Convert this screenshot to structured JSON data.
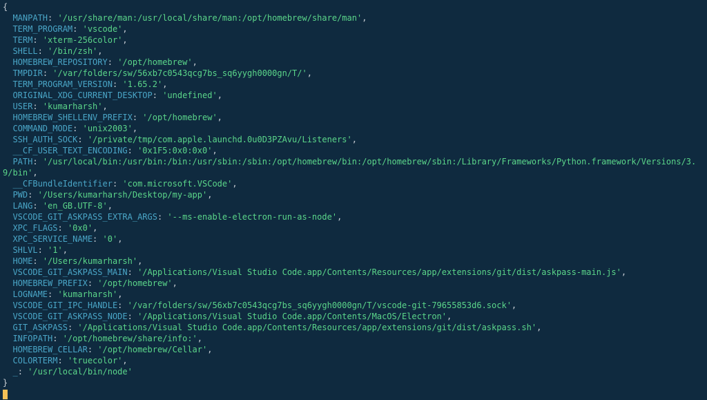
{
  "open_brace": "{",
  "close_brace": "}",
  "env": [
    {
      "key": "MANPATH",
      "value": "/usr/share/man:/usr/local/share/man:/opt/homebrew/share/man"
    },
    {
      "key": "TERM_PROGRAM",
      "value": "vscode"
    },
    {
      "key": "TERM",
      "value": "xterm-256color"
    },
    {
      "key": "SHELL",
      "value": "/bin/zsh"
    },
    {
      "key": "HOMEBREW_REPOSITORY",
      "value": "/opt/homebrew"
    },
    {
      "key": "TMPDIR",
      "value": "/var/folders/sw/56xb7c0543qcg7bs_sq6yygh0000gn/T/"
    },
    {
      "key": "TERM_PROGRAM_VERSION",
      "value": "1.65.2"
    },
    {
      "key": "ORIGINAL_XDG_CURRENT_DESKTOP",
      "value": "undefined"
    },
    {
      "key": "USER",
      "value": "kumarharsh"
    },
    {
      "key": "HOMEBREW_SHELLENV_PREFIX",
      "value": "/opt/homebrew"
    },
    {
      "key": "COMMAND_MODE",
      "value": "unix2003"
    },
    {
      "key": "SSH_AUTH_SOCK",
      "value": "/private/tmp/com.apple.launchd.0u0D3PZAvu/Listeners"
    },
    {
      "key": "__CF_USER_TEXT_ENCODING",
      "value": "0x1F5:0x0:0x0"
    },
    {
      "key": "PATH",
      "value": "/usr/local/bin:/usr/bin:/bin:/usr/sbin:/sbin:/opt/homebrew/bin:/opt/homebrew/sbin:/Library/Frameworks/Python.framework/Versions/3.9/bin"
    },
    {
      "key": "__CFBundleIdentifier",
      "value": "com.microsoft.VSCode"
    },
    {
      "key": "PWD",
      "value": "/Users/kumarharsh/Desktop/my-app"
    },
    {
      "key": "LANG",
      "value": "en_GB.UTF-8"
    },
    {
      "key": "VSCODE_GIT_ASKPASS_EXTRA_ARGS",
      "value": "--ms-enable-electron-run-as-node"
    },
    {
      "key": "XPC_FLAGS",
      "value": "0x0"
    },
    {
      "key": "XPC_SERVICE_NAME",
      "value": "0"
    },
    {
      "key": "SHLVL",
      "value": "1"
    },
    {
      "key": "HOME",
      "value": "/Users/kumarharsh"
    },
    {
      "key": "VSCODE_GIT_ASKPASS_MAIN",
      "value": "/Applications/Visual Studio Code.app/Contents/Resources/app/extensions/git/dist/askpass-main.js"
    },
    {
      "key": "HOMEBREW_PREFIX",
      "value": "/opt/homebrew"
    },
    {
      "key": "LOGNAME",
      "value": "kumarharsh"
    },
    {
      "key": "VSCODE_GIT_IPC_HANDLE",
      "value": "/var/folders/sw/56xb7c0543qcg7bs_sq6yygh0000gn/T/vscode-git-79655853d6.sock"
    },
    {
      "key": "VSCODE_GIT_ASKPASS_NODE",
      "value": "/Applications/Visual Studio Code.app/Contents/MacOS/Electron"
    },
    {
      "key": "GIT_ASKPASS",
      "value": "/Applications/Visual Studio Code.app/Contents/Resources/app/extensions/git/dist/askpass.sh"
    },
    {
      "key": "INFOPATH",
      "value": "/opt/homebrew/share/info:"
    },
    {
      "key": "HOMEBREW_CELLAR",
      "value": "/opt/homebrew/Cellar"
    },
    {
      "key": "COLORTERM",
      "value": "truecolor"
    },
    {
      "key": "_",
      "value": "/usr/local/bin/node"
    }
  ]
}
